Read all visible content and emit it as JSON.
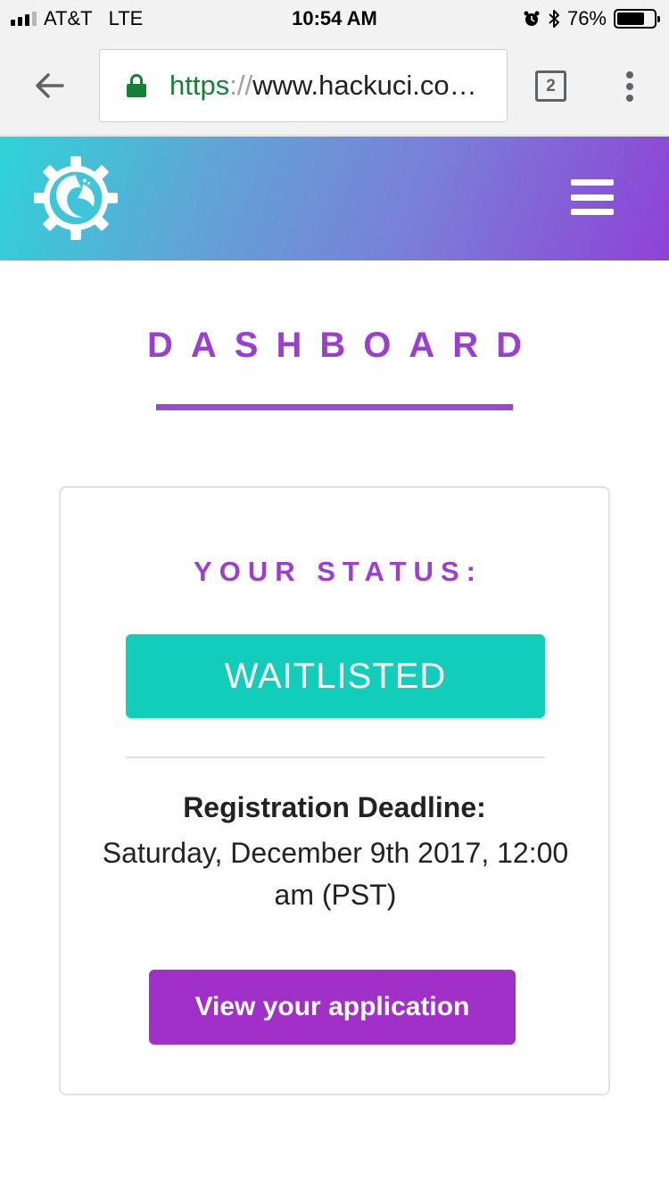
{
  "status_bar": {
    "carrier": "AT&T",
    "network": "LTE",
    "time": "10:54 AM",
    "battery_percent": "76%",
    "battery_level": 0.76,
    "signal_bars": 3,
    "icons": [
      "alarm-icon",
      "bluetooth-icon",
      "battery-icon"
    ]
  },
  "browser": {
    "url_scheme": "https",
    "url_separator": "://",
    "url_host": "www.hackuci.co…",
    "tab_count": "2",
    "icons": [
      "back-arrow-icon",
      "lock-icon",
      "tabs-icon",
      "overflow-menu-icon"
    ]
  },
  "site_header": {
    "icons": [
      "hackuci-logo",
      "hamburger-menu-icon"
    ],
    "gradient_colors": [
      "#2ed4d8",
      "#8e42d6"
    ]
  },
  "dashboard": {
    "title": "DASHBOARD",
    "accent_color": "#9b3fcf"
  },
  "status_card": {
    "heading": "YOUR STATUS:",
    "status": "WAITLISTED",
    "status_color": "#11cdb9",
    "deadline_label": "Registration Deadline:",
    "deadline_value": "Saturday, December 9th 2017, 12:00 am (PST)",
    "view_application_label": "View your application",
    "button_color": "#a030c8"
  }
}
